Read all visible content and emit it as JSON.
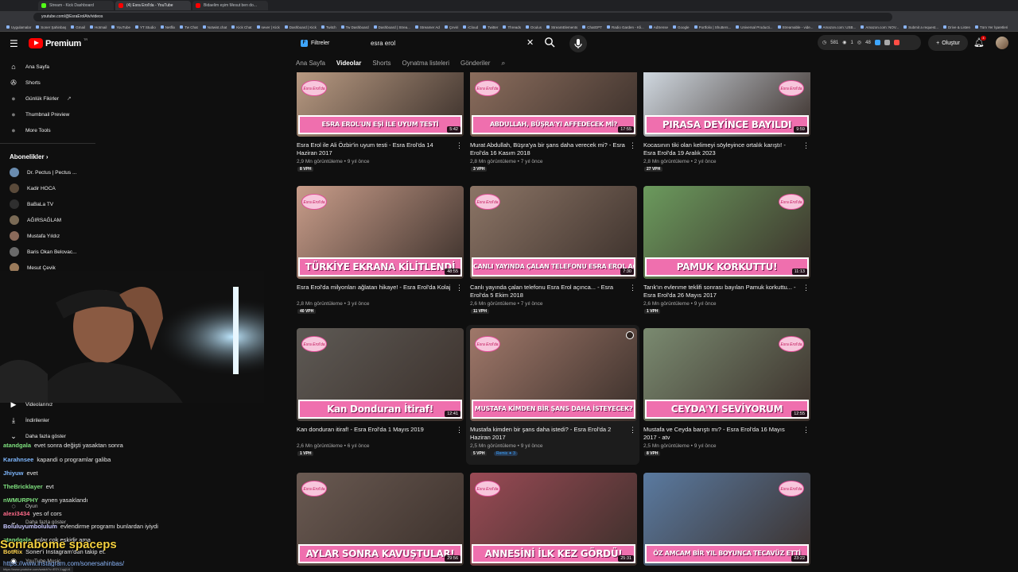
{
  "browser": {
    "tabs": [
      {
        "label": "Stream - Kick Dashboard",
        "color": "#53fc18"
      },
      {
        "label": "(4) Esra Erol'da - YouTube",
        "color": "#ff0000"
      },
      {
        "label": "Bidaelim eşim Mesut ben do...",
        "color": "#ff0000"
      }
    ],
    "url": "youtube.com/@EsraErolAtv/videos",
    "bookmarks": [
      "Uygulamalar",
      "Soner Şahinbaş",
      "Gmail",
      "Hotmail",
      "YouTube",
      "YT Studio",
      "Netflix",
      "Tw Chat",
      "Notwist.chat",
      "Kick Chat",
      "sever | Kick",
      "Dashboard | Kick",
      "Twitch",
      "Tw Dashboard",
      "Dashboard | Strea...",
      "Streamer Ad",
      "Çeviri",
      "iCloud",
      "Twitter",
      "Threads",
      "Oculus",
      "StreamElements",
      "ChatGPT",
      "Radio Garden - Kli...",
      "AdSense",
      "Google",
      "Portfolio | Shutters...",
      "Universal Producti...",
      "Streamable - vide...",
      "Amazon.com: USB...",
      "Amazon.com: NOV...",
      "Submit a request...",
      "Drive & Listen",
      "Tüm Yer İşaretleri"
    ]
  },
  "masthead": {
    "logo_text": "Premium",
    "logo_sup": "TR",
    "filters_label": "Filtreler",
    "search_value": "esra erol",
    "ext_stats": [
      "581",
      "1",
      "48"
    ],
    "create_label": "Oluştur",
    "notif_count": "4"
  },
  "channel_tabs": [
    "Ana Sayfa",
    "Videolar",
    "Shorts",
    "Oynatma listeleri",
    "Gönderiler"
  ],
  "sidebar": {
    "nav": [
      {
        "label": "Ana Sayfa",
        "icon": "⌂"
      },
      {
        "label": "Shorts",
        "icon": "✇"
      },
      {
        "label": "Günlük Fikirler",
        "icon": "●"
      },
      {
        "label": "Thumbnail Preview",
        "icon": "●"
      },
      {
        "label": "More Tools",
        "icon": "●"
      }
    ],
    "subs_heading": "Abonelikler",
    "channels": [
      {
        "name": "Dr. Pectus | Pectus ...",
        "color": "#6a8caf"
      },
      {
        "name": "Kadir HOCA",
        "color": "#5a4a3a"
      },
      {
        "name": "BaBaLa TV",
        "color": "#2f2f2f"
      },
      {
        "name": "AĞIRSAĞLAM",
        "color": "#7a6a55"
      },
      {
        "name": "Mustafa Yıldız",
        "color": "#8a6a5a"
      },
      {
        "name": "Baris Okan Belovac...",
        "color": "#6a6a6a"
      },
      {
        "name": "Mesut Çevik",
        "color": "#9a7a5a"
      }
    ],
    "lower": [
      {
        "label": "Videolarınız",
        "icon": "▶"
      },
      {
        "label": "İndirilenler",
        "icon": "⤓"
      },
      {
        "label": "Daha fazla göster",
        "icon": "⌄"
      }
    ]
  },
  "chat": [
    {
      "user": "atandgala",
      "color": "#7ee07e",
      "msg": "evet sonra değişti yasaktan sonra"
    },
    {
      "user": "Karahnsee",
      "color": "#7fb8ff",
      "msg": "kapandi o programlar galiba"
    },
    {
      "user": "Jhiyuw",
      "color": "#7fb8ff",
      "msg": "evet"
    },
    {
      "user": "TheBricklayer",
      "color": "#7ee07e",
      "msg": "evt"
    },
    {
      "user": "nWMURPHY",
      "color": "#7ee07e",
      "msg": "aynen yasaklandı"
    },
    {
      "user": "alexi3434",
      "color": "#ff6b8a",
      "msg": "yes of cors"
    },
    {
      "user": "Boluluyumbolulum",
      "color": "#c6c6ff",
      "msg": "evlendirme programı bunlardan iyiydi"
    },
    {
      "user": "atandgala",
      "color": "#7ee07e",
      "msg": "onlar çok eskidir ama"
    },
    {
      "user": "BotRix",
      "color": "#ffd34d",
      "msg": "Soner'i Instagram'dan takip et:"
    }
  ],
  "chat_extra": {
    "dyun": "Oyun",
    "daha": "Daha fazla göster",
    "ytmusic": "YouTube Music"
  },
  "overlay_name": "Sonrabome spaceps",
  "instagram": "https://www.instagram.com/sonersahinbas/",
  "status_url": "https://www.youtube.com/watch?v=ESY-1qgjU4",
  "videos": [
    {
      "title": "Esra Erol ile Ali Özbir'in uyum testi - Esra Erol'da 14 Haziran 2017",
      "views": "2,9 Mn görüntüleme",
      "age": "9 yıl önce",
      "vph": "8 VPH",
      "duration": "5:42",
      "banner": "ESRA EROL'UN EŞİ İLE UYUM TESTİ",
      "bg": "#b89a82"
    },
    {
      "title": "Murat Abdullah, Büşra'ya bir şans daha verecek mi? - Esra Erol'da 16 Kasım 2018",
      "views": "2,8 Mn görüntüleme",
      "age": "7 yıl önce",
      "vph": "3 VPH",
      "duration": "17:55",
      "banner": "ABDULLAH, BÜŞRA'YI AFFEDECEK Mİ?",
      "bg": "#8b6d5d"
    },
    {
      "title": "Kocasının tiki olan kelimeyi söyleyince ortalık karıştı! - Esra Erol'da 19 Aralık 2023",
      "views": "2,8 Mn görüntüleme",
      "age": "2 yıl önce",
      "vph": "27 VPH",
      "duration": "9:59",
      "banner": "PIRASA DEYİNCE BAYILDI",
      "bg": "#cfd7df"
    },
    {
      "title": "Esra Erol'da milyonları ağlatan hikaye! - Esra Erol'da Kolaj",
      "views": "2,8 Mn görüntüleme",
      "age": "3 yıl önce",
      "vph": "40 VPH",
      "duration": "48:55",
      "banner": "TÜRKİYE EKRANA KİLİTLENDİ",
      "bg": "#c99d8a"
    },
    {
      "title": "Canlı yayında çalan telefonu Esra Erol açınca... - Esra Erol'da 5 Ekim 2018",
      "views": "2,6 Mn görüntüleme",
      "age": "7 yıl önce",
      "vph": "11 VPH",
      "duration": "7:30",
      "banner": "CANLI YAYINDA ÇALAN TELEFONU ESRA EROL AÇINCA",
      "bg": "#8c7566"
    },
    {
      "title": "Tarık'ın evlenme teklifi sonrası bayılan Pamuk korkuttu... - Esra Erol'da 26 Mayıs 2017",
      "views": "2,6 Mn görüntüleme",
      "age": "9 yıl önce",
      "vph": "1 VPH",
      "duration": "11:13",
      "banner": "PAMUK KORKUTTU!",
      "bg": "#6b9a5d"
    },
    {
      "title": "Kan donduran itiraf! - Esra Erol'da 1 Mayıs 2019",
      "views": "2,6 Mn görüntüleme",
      "age": "6 yıl önce",
      "vph": "1 VPH",
      "duration": "12:41",
      "banner": "Kan Donduran İtiraf!",
      "bg": "#5e5a55"
    },
    {
      "title": "Mustafa kimden bir şans daha istedi? - Esra Erol'da 2 Haziran 2017",
      "views": "2,5 Mn görüntüleme",
      "age": "9 yıl önce",
      "vph": "5 VPH",
      "duration": "",
      "banner": "MUSTAFA KİMDEN BİR ŞANS DAHA İSTEYECEK?",
      "bg": "#a0786a",
      "remix": "Remix ✦ 3"
    },
    {
      "title": "Mustafa ve Ceyda barıştı mı? - Esra Erol'da 16 Mayıs 2017 - atv",
      "views": "2,5 Mn görüntüleme",
      "age": "9 yıl önce",
      "vph": "8 VPH",
      "duration": "12:55",
      "banner": "CEYDA'YI SEVİYORUM",
      "bg": "#7a8a70"
    },
    {
      "title": "",
      "views": "",
      "age": "",
      "vph": "",
      "duration": "29:56",
      "banner": "AYLAR SONRA KAVUŞTULAR!",
      "bg": "#6a5a52"
    },
    {
      "title": "",
      "views": "",
      "age": "",
      "vph": "",
      "duration": "25:31",
      "banner": "ANNESİNİ İLK KEZ GÖRDÜ!",
      "bg": "#9a4a55"
    },
    {
      "title": "",
      "views": "",
      "age": "",
      "vph": "",
      "duration": "23:22",
      "banner": "ÖZ AMCAM BİR YIL BOYUNCA TECAVÜZ ETTİ",
      "bg": "#5a7aa0"
    }
  ]
}
